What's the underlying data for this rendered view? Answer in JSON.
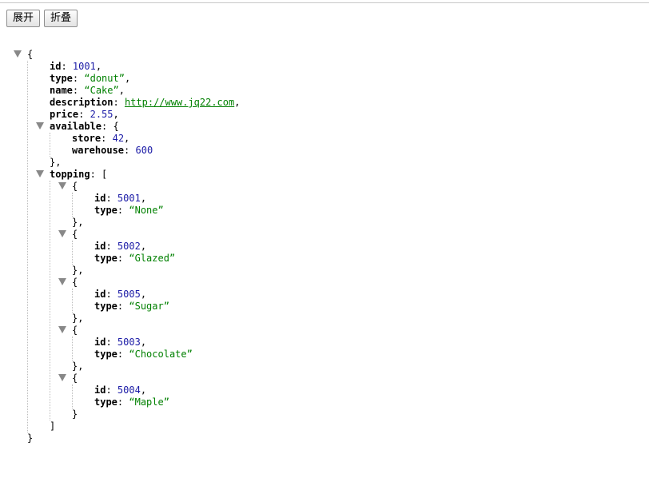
{
  "toolbar": {
    "expand_label": "展开",
    "collapse_label": "折叠"
  },
  "json_viewer": {
    "punct": {
      "open_brace": "{",
      "close_brace": "}",
      "open_bracket": "[",
      "close_bracket": "]",
      "comma": ",",
      "colon": ":",
      "quote_open": "“",
      "quote_close": "”"
    },
    "lines": [
      {
        "open": "{",
        "collapsible": true
      },
      {
        "key": "id",
        "value": "1001",
        "vtype": "num",
        "comma": true
      },
      {
        "key": "type",
        "value": "donut",
        "vtype": "str",
        "comma": true
      },
      {
        "key": "name",
        "value": "Cake",
        "vtype": "str",
        "comma": true
      },
      {
        "key": "description",
        "value": "http://www.jq22.com",
        "vtype": "link",
        "comma": true
      },
      {
        "key": "price",
        "value": "2.55",
        "vtype": "num",
        "comma": true
      },
      {
        "key": "available",
        "open": "{",
        "collapsible": true
      },
      {
        "key": "store",
        "value": "42",
        "vtype": "num",
        "comma": true
      },
      {
        "key": "warehouse",
        "value": "600",
        "vtype": "num"
      },
      {
        "close": "}",
        "comma": true
      },
      {
        "key": "topping",
        "open": "[",
        "collapsible": true
      },
      {
        "open": "{",
        "collapsible": true
      },
      {
        "key": "id",
        "value": "5001",
        "vtype": "num",
        "comma": true
      },
      {
        "key": "type",
        "value": "None",
        "vtype": "str"
      },
      {
        "close": "}",
        "comma": true
      },
      {
        "open": "{",
        "collapsible": true
      },
      {
        "key": "id",
        "value": "5002",
        "vtype": "num",
        "comma": true
      },
      {
        "key": "type",
        "value": "Glazed",
        "vtype": "str"
      },
      {
        "close": "}",
        "comma": true
      },
      {
        "open": "{",
        "collapsible": true
      },
      {
        "key": "id",
        "value": "5005",
        "vtype": "num",
        "comma": true
      },
      {
        "key": "type",
        "value": "Sugar",
        "vtype": "str"
      },
      {
        "close": "}",
        "comma": true
      },
      {
        "open": "{",
        "collapsible": true
      },
      {
        "key": "id",
        "value": "5003",
        "vtype": "num",
        "comma": true
      },
      {
        "key": "type",
        "value": "Chocolate",
        "vtype": "str"
      },
      {
        "close": "}",
        "comma": true
      },
      {
        "open": "{",
        "collapsible": true
      },
      {
        "key": "id",
        "value": "5004",
        "vtype": "num",
        "comma": true
      },
      {
        "key": "type",
        "value": "Maple",
        "vtype": "str"
      },
      {
        "close": "}"
      },
      {
        "close": "]"
      },
      {
        "close": "}"
      }
    ]
  },
  "colors": {
    "key": "#000000",
    "number": "#1a1aa6",
    "string": "#008000",
    "toggle": "#888888"
  }
}
